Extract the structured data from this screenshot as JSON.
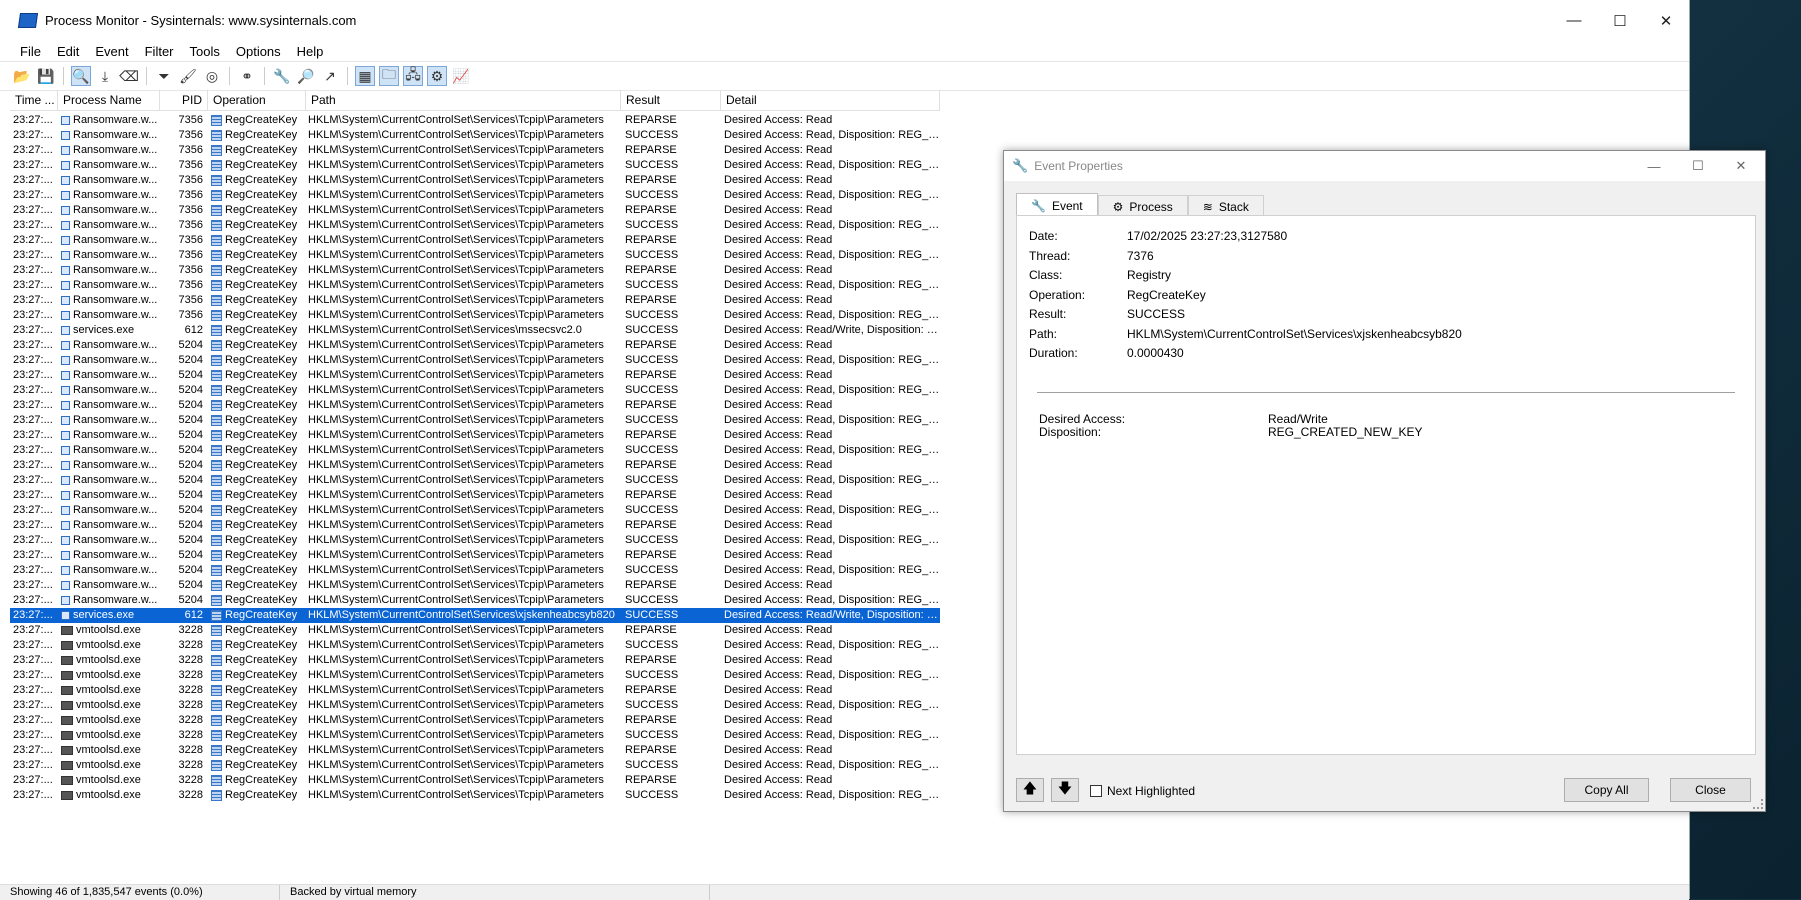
{
  "window": {
    "title": "Process Monitor - Sysinternals: www.sysinternals.com",
    "minimize": "—",
    "maximize": "☐",
    "close": "✕"
  },
  "menu": [
    "File",
    "Edit",
    "Event",
    "Filter",
    "Tools",
    "Options",
    "Help"
  ],
  "toolbar": [
    {
      "name": "open-icon",
      "glyph": "📂"
    },
    {
      "name": "save-icon",
      "glyph": "💾"
    },
    {
      "sep": true
    },
    {
      "name": "capture-icon",
      "glyph": "🔍",
      "active": true
    },
    {
      "name": "autoscroll-icon",
      "glyph": "⤓"
    },
    {
      "name": "clear-icon",
      "glyph": "⌫"
    },
    {
      "sep": true
    },
    {
      "name": "filter-icon",
      "glyph": "⏷"
    },
    {
      "name": "highlight-icon",
      "glyph": "🖌"
    },
    {
      "name": "target-icon",
      "glyph": "◎"
    },
    {
      "sep": true
    },
    {
      "name": "process-tree-icon",
      "glyph": "⚭"
    },
    {
      "sep": true
    },
    {
      "name": "properties-icon",
      "glyph": "🔧"
    },
    {
      "name": "find-icon",
      "glyph": "🔎"
    },
    {
      "name": "jump-icon",
      "glyph": "↗"
    },
    {
      "sep": true
    },
    {
      "name": "registry-activity-icon",
      "glyph": "▦",
      "active": true
    },
    {
      "name": "filesystem-activity-icon",
      "glyph": "🗀",
      "active": true
    },
    {
      "name": "network-activity-icon",
      "glyph": "🖧",
      "active": true
    },
    {
      "name": "process-activity-icon",
      "glyph": "⚙",
      "active": true
    },
    {
      "name": "profiling-icon",
      "glyph": "📈"
    }
  ],
  "columns": [
    "Time ...",
    "Process Name",
    "PID",
    "Operation",
    "Path",
    "Result",
    "Detail"
  ],
  "rows": [
    [
      "23:27:...",
      "Ransomware.w...",
      "7356",
      "RegCreateKey",
      "HKLM\\System\\CurrentControlSet\\Services\\Tcpip\\Parameters",
      "REPARSE",
      "Desired Access: Read"
    ],
    [
      "23:27:...",
      "Ransomware.w...",
      "7356",
      "RegCreateKey",
      "HKLM\\System\\CurrentControlSet\\Services\\Tcpip\\Parameters",
      "SUCCESS",
      "Desired Access: Read, Disposition: REG_OP..."
    ],
    [
      "23:27:...",
      "Ransomware.w...",
      "7356",
      "RegCreateKey",
      "HKLM\\System\\CurrentControlSet\\Services\\Tcpip\\Parameters",
      "REPARSE",
      "Desired Access: Read"
    ],
    [
      "23:27:...",
      "Ransomware.w...",
      "7356",
      "RegCreateKey",
      "HKLM\\System\\CurrentControlSet\\Services\\Tcpip\\Parameters",
      "SUCCESS",
      "Desired Access: Read, Disposition: REG_OP..."
    ],
    [
      "23:27:...",
      "Ransomware.w...",
      "7356",
      "RegCreateKey",
      "HKLM\\System\\CurrentControlSet\\Services\\Tcpip\\Parameters",
      "REPARSE",
      "Desired Access: Read"
    ],
    [
      "23:27:...",
      "Ransomware.w...",
      "7356",
      "RegCreateKey",
      "HKLM\\System\\CurrentControlSet\\Services\\Tcpip\\Parameters",
      "SUCCESS",
      "Desired Access: Read, Disposition: REG_OP..."
    ],
    [
      "23:27:...",
      "Ransomware.w...",
      "7356",
      "RegCreateKey",
      "HKLM\\System\\CurrentControlSet\\Services\\Tcpip\\Parameters",
      "REPARSE",
      "Desired Access: Read"
    ],
    [
      "23:27:...",
      "Ransomware.w...",
      "7356",
      "RegCreateKey",
      "HKLM\\System\\CurrentControlSet\\Services\\Tcpip\\Parameters",
      "SUCCESS",
      "Desired Access: Read, Disposition: REG_OP..."
    ],
    [
      "23:27:...",
      "Ransomware.w...",
      "7356",
      "RegCreateKey",
      "HKLM\\System\\CurrentControlSet\\Services\\Tcpip\\Parameters",
      "REPARSE",
      "Desired Access: Read"
    ],
    [
      "23:27:...",
      "Ransomware.w...",
      "7356",
      "RegCreateKey",
      "HKLM\\System\\CurrentControlSet\\Services\\Tcpip\\Parameters",
      "SUCCESS",
      "Desired Access: Read, Disposition: REG_OP..."
    ],
    [
      "23:27:...",
      "Ransomware.w...",
      "7356",
      "RegCreateKey",
      "HKLM\\System\\CurrentControlSet\\Services\\Tcpip\\Parameters",
      "REPARSE",
      "Desired Access: Read"
    ],
    [
      "23:27:...",
      "Ransomware.w...",
      "7356",
      "RegCreateKey",
      "HKLM\\System\\CurrentControlSet\\Services\\Tcpip\\Parameters",
      "SUCCESS",
      "Desired Access: Read, Disposition: REG_OP..."
    ],
    [
      "23:27:...",
      "Ransomware.w...",
      "7356",
      "RegCreateKey",
      "HKLM\\System\\CurrentControlSet\\Services\\Tcpip\\Parameters",
      "REPARSE",
      "Desired Access: Read"
    ],
    [
      "23:27:...",
      "Ransomware.w...",
      "7356",
      "RegCreateKey",
      "HKLM\\System\\CurrentControlSet\\Services\\Tcpip\\Parameters",
      "SUCCESS",
      "Desired Access: Read, Disposition: REG_OP..."
    ],
    [
      "23:27:...",
      "services.exe",
      "612",
      "RegCreateKey",
      "HKLM\\System\\CurrentControlSet\\Services\\mssecsvc2.0",
      "SUCCESS",
      "Desired Access: Read/Write, Disposition: RE..."
    ],
    [
      "23:27:...",
      "Ransomware.w...",
      "5204",
      "RegCreateKey",
      "HKLM\\System\\CurrentControlSet\\Services\\Tcpip\\Parameters",
      "REPARSE",
      "Desired Access: Read"
    ],
    [
      "23:27:...",
      "Ransomware.w...",
      "5204",
      "RegCreateKey",
      "HKLM\\System\\CurrentControlSet\\Services\\Tcpip\\Parameters",
      "SUCCESS",
      "Desired Access: Read, Disposition: REG_OP..."
    ],
    [
      "23:27:...",
      "Ransomware.w...",
      "5204",
      "RegCreateKey",
      "HKLM\\System\\CurrentControlSet\\Services\\Tcpip\\Parameters",
      "REPARSE",
      "Desired Access: Read"
    ],
    [
      "23:27:...",
      "Ransomware.w...",
      "5204",
      "RegCreateKey",
      "HKLM\\System\\CurrentControlSet\\Services\\Tcpip\\Parameters",
      "SUCCESS",
      "Desired Access: Read, Disposition: REG_OP..."
    ],
    [
      "23:27:...",
      "Ransomware.w...",
      "5204",
      "RegCreateKey",
      "HKLM\\System\\CurrentControlSet\\Services\\Tcpip\\Parameters",
      "REPARSE",
      "Desired Access: Read"
    ],
    [
      "23:27:...",
      "Ransomware.w...",
      "5204",
      "RegCreateKey",
      "HKLM\\System\\CurrentControlSet\\Services\\Tcpip\\Parameters",
      "SUCCESS",
      "Desired Access: Read, Disposition: REG_OP..."
    ],
    [
      "23:27:...",
      "Ransomware.w...",
      "5204",
      "RegCreateKey",
      "HKLM\\System\\CurrentControlSet\\Services\\Tcpip\\Parameters",
      "REPARSE",
      "Desired Access: Read"
    ],
    [
      "23:27:...",
      "Ransomware.w...",
      "5204",
      "RegCreateKey",
      "HKLM\\System\\CurrentControlSet\\Services\\Tcpip\\Parameters",
      "SUCCESS",
      "Desired Access: Read, Disposition: REG_OP..."
    ],
    [
      "23:27:...",
      "Ransomware.w...",
      "5204",
      "RegCreateKey",
      "HKLM\\System\\CurrentControlSet\\Services\\Tcpip\\Parameters",
      "REPARSE",
      "Desired Access: Read"
    ],
    [
      "23:27:...",
      "Ransomware.w...",
      "5204",
      "RegCreateKey",
      "HKLM\\System\\CurrentControlSet\\Services\\Tcpip\\Parameters",
      "SUCCESS",
      "Desired Access: Read, Disposition: REG_OP..."
    ],
    [
      "23:27:...",
      "Ransomware.w...",
      "5204",
      "RegCreateKey",
      "HKLM\\System\\CurrentControlSet\\Services\\Tcpip\\Parameters",
      "REPARSE",
      "Desired Access: Read"
    ],
    [
      "23:27:...",
      "Ransomware.w...",
      "5204",
      "RegCreateKey",
      "HKLM\\System\\CurrentControlSet\\Services\\Tcpip\\Parameters",
      "SUCCESS",
      "Desired Access: Read, Disposition: REG_OP..."
    ],
    [
      "23:27:...",
      "Ransomware.w...",
      "5204",
      "RegCreateKey",
      "HKLM\\System\\CurrentControlSet\\Services\\Tcpip\\Parameters",
      "REPARSE",
      "Desired Access: Read"
    ],
    [
      "23:27:...",
      "Ransomware.w...",
      "5204",
      "RegCreateKey",
      "HKLM\\System\\CurrentControlSet\\Services\\Tcpip\\Parameters",
      "SUCCESS",
      "Desired Access: Read, Disposition: REG_OP..."
    ],
    [
      "23:27:...",
      "Ransomware.w...",
      "5204",
      "RegCreateKey",
      "HKLM\\System\\CurrentControlSet\\Services\\Tcpip\\Parameters",
      "REPARSE",
      "Desired Access: Read"
    ],
    [
      "23:27:...",
      "Ransomware.w...",
      "5204",
      "RegCreateKey",
      "HKLM\\System\\CurrentControlSet\\Services\\Tcpip\\Parameters",
      "SUCCESS",
      "Desired Access: Read, Disposition: REG_OP..."
    ],
    [
      "23:27:...",
      "Ransomware.w...",
      "5204",
      "RegCreateKey",
      "HKLM\\System\\CurrentControlSet\\Services\\Tcpip\\Parameters",
      "REPARSE",
      "Desired Access: Read"
    ],
    [
      "23:27:...",
      "Ransomware.w...",
      "5204",
      "RegCreateKey",
      "HKLM\\System\\CurrentControlSet\\Services\\Tcpip\\Parameters",
      "SUCCESS",
      "Desired Access: Read, Disposition: REG_OP..."
    ],
    [
      "23:27:...",
      "services.exe",
      "612",
      "RegCreateKey",
      "HKLM\\System\\CurrentControlSet\\Services\\xjskenheabcsyb820",
      "SUCCESS",
      "Desired Access: Read/Write, Disposition: RE..."
    ],
    [
      "23:27:...",
      "vmtoolsd.exe",
      "3228",
      "RegCreateKey",
      "HKLM\\System\\CurrentControlSet\\Services\\Tcpip\\Parameters",
      "REPARSE",
      "Desired Access: Read"
    ],
    [
      "23:27:...",
      "vmtoolsd.exe",
      "3228",
      "RegCreateKey",
      "HKLM\\System\\CurrentControlSet\\Services\\Tcpip\\Parameters",
      "SUCCESS",
      "Desired Access: Read, Disposition: REG_OP..."
    ],
    [
      "23:27:...",
      "vmtoolsd.exe",
      "3228",
      "RegCreateKey",
      "HKLM\\System\\CurrentControlSet\\Services\\Tcpip\\Parameters",
      "REPARSE",
      "Desired Access: Read"
    ],
    [
      "23:27:...",
      "vmtoolsd.exe",
      "3228",
      "RegCreateKey",
      "HKLM\\System\\CurrentControlSet\\Services\\Tcpip\\Parameters",
      "SUCCESS",
      "Desired Access: Read, Disposition: REG_OP..."
    ],
    [
      "23:27:...",
      "vmtoolsd.exe",
      "3228",
      "RegCreateKey",
      "HKLM\\System\\CurrentControlSet\\Services\\Tcpip\\Parameters",
      "REPARSE",
      "Desired Access: Read"
    ],
    [
      "23:27:...",
      "vmtoolsd.exe",
      "3228",
      "RegCreateKey",
      "HKLM\\System\\CurrentControlSet\\Services\\Tcpip\\Parameters",
      "SUCCESS",
      "Desired Access: Read, Disposition: REG_OP..."
    ],
    [
      "23:27:...",
      "vmtoolsd.exe",
      "3228",
      "RegCreateKey",
      "HKLM\\System\\CurrentControlSet\\Services\\Tcpip\\Parameters",
      "REPARSE",
      "Desired Access: Read"
    ],
    [
      "23:27:...",
      "vmtoolsd.exe",
      "3228",
      "RegCreateKey",
      "HKLM\\System\\CurrentControlSet\\Services\\Tcpip\\Parameters",
      "SUCCESS",
      "Desired Access: Read, Disposition: REG_OP..."
    ],
    [
      "23:27:...",
      "vmtoolsd.exe",
      "3228",
      "RegCreateKey",
      "HKLM\\System\\CurrentControlSet\\Services\\Tcpip\\Parameters",
      "REPARSE",
      "Desired Access: Read"
    ],
    [
      "23:27:...",
      "vmtoolsd.exe",
      "3228",
      "RegCreateKey",
      "HKLM\\System\\CurrentControlSet\\Services\\Tcpip\\Parameters",
      "SUCCESS",
      "Desired Access: Read, Disposition: REG_OP..."
    ],
    [
      "23:27:...",
      "vmtoolsd.exe",
      "3228",
      "RegCreateKey",
      "HKLM\\System\\CurrentControlSet\\Services\\Tcpip\\Parameters",
      "REPARSE",
      "Desired Access: Read"
    ],
    [
      "23:27:...",
      "vmtoolsd.exe",
      "3228",
      "RegCreateKey",
      "HKLM\\System\\CurrentControlSet\\Services\\Tcpip\\Parameters",
      "SUCCESS",
      "Desired Access: Read, Disposition: REG_OP..."
    ]
  ],
  "selected_row": 33,
  "status": {
    "events": "Showing 46 of 1,835,547 events (0.0%)",
    "memory": "Backed by virtual memory"
  },
  "dialog": {
    "title": "Event Properties",
    "tabs": [
      "Event",
      "Process",
      "Stack"
    ],
    "fields": [
      {
        "label": "Date:",
        "value": "17/02/2025 23:27:23,3127580"
      },
      {
        "label": "Thread:",
        "value": "7376"
      },
      {
        "label": "Class:",
        "value": "Registry"
      },
      {
        "label": "Operation:",
        "value": "RegCreateKey"
      },
      {
        "label": "Result:",
        "value": "SUCCESS"
      },
      {
        "label": "Path:",
        "value": "HKLM\\System\\CurrentControlSet\\Services\\xjskenheabcsyb820"
      },
      {
        "label": "Duration:",
        "value": "0.0000430"
      }
    ],
    "details": [
      {
        "label": "Desired Access:",
        "value": "Read/Write"
      },
      {
        "label": "Disposition:",
        "value": "REG_CREATED_NEW_KEY"
      }
    ],
    "next_highlighted": "Next Highlighted",
    "copy_all": "Copy All",
    "close": "Close"
  }
}
